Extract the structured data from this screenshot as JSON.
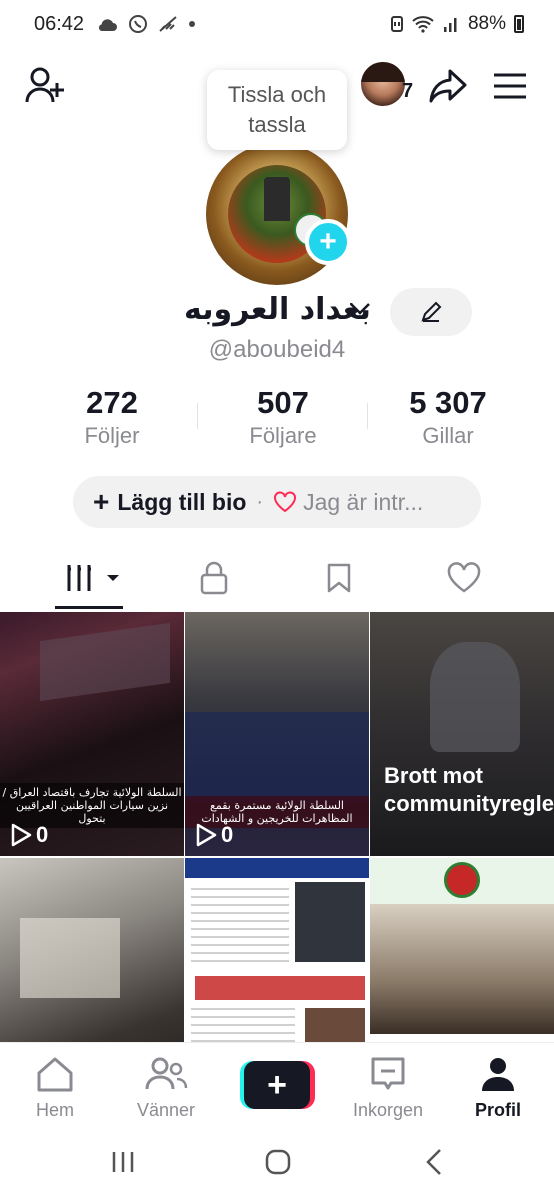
{
  "status_bar": {
    "time": "06:42",
    "battery": "88%",
    "icons": [
      "cloud-icon",
      "viber-icon",
      "signal-muted-icon",
      "dot-icon",
      "nfc-icon",
      "wifi-icon",
      "cell-signal-icon",
      "battery-icon"
    ]
  },
  "header": {
    "add_friend_icon": "person-plus-icon",
    "notification_count": "7",
    "share_icon": "share-arrow-icon",
    "menu_icon": "hamburger-icon",
    "tooltip": "Tissla och tassla"
  },
  "profile": {
    "display_name": "بغداد العروبه",
    "handle": "@aboubeid4",
    "edit_icon": "pencil-icon"
  },
  "stats": [
    {
      "value": "272",
      "label": "Följer"
    },
    {
      "value": "507",
      "label": "Följare"
    },
    {
      "value": "5 307",
      "label": "Gillar"
    }
  ],
  "bio": {
    "add_label": "Lägg till bio",
    "separator": "·",
    "interest_label": "Jag är intr..."
  },
  "tabs": [
    "videos-grid-icon",
    "lock-icon",
    "bookmark-icon",
    "heart-icon"
  ],
  "grid": {
    "items": [
      {
        "views": "0",
        "caption": "السلطة الولائية تجارف باقتصاد العراق / نزين سيارات المواطنين العراقيين بتحول"
      },
      {
        "views": "0",
        "caption": "السلطة الولائية مستمرة بقمع المظاهرات للخريجين و الشهادات"
      },
      {
        "restricted": "Brott mot communityregler"
      },
      {},
      {},
      {}
    ]
  },
  "bottom_nav": [
    {
      "label": "Hem",
      "icon": "home-icon"
    },
    {
      "label": "Vänner",
      "icon": "friends-icon"
    },
    {
      "label": "+",
      "icon": "create-icon"
    },
    {
      "label": "Inkorgen",
      "icon": "inbox-icon"
    },
    {
      "label": "Profil",
      "icon": "profile-icon"
    }
  ],
  "colors": {
    "accent_cyan": "#25f4ee",
    "accent_red": "#fe2c55",
    "plus_badge": "#20d5ec",
    "text_primary": "#161823",
    "text_secondary": "#8a8b91"
  }
}
